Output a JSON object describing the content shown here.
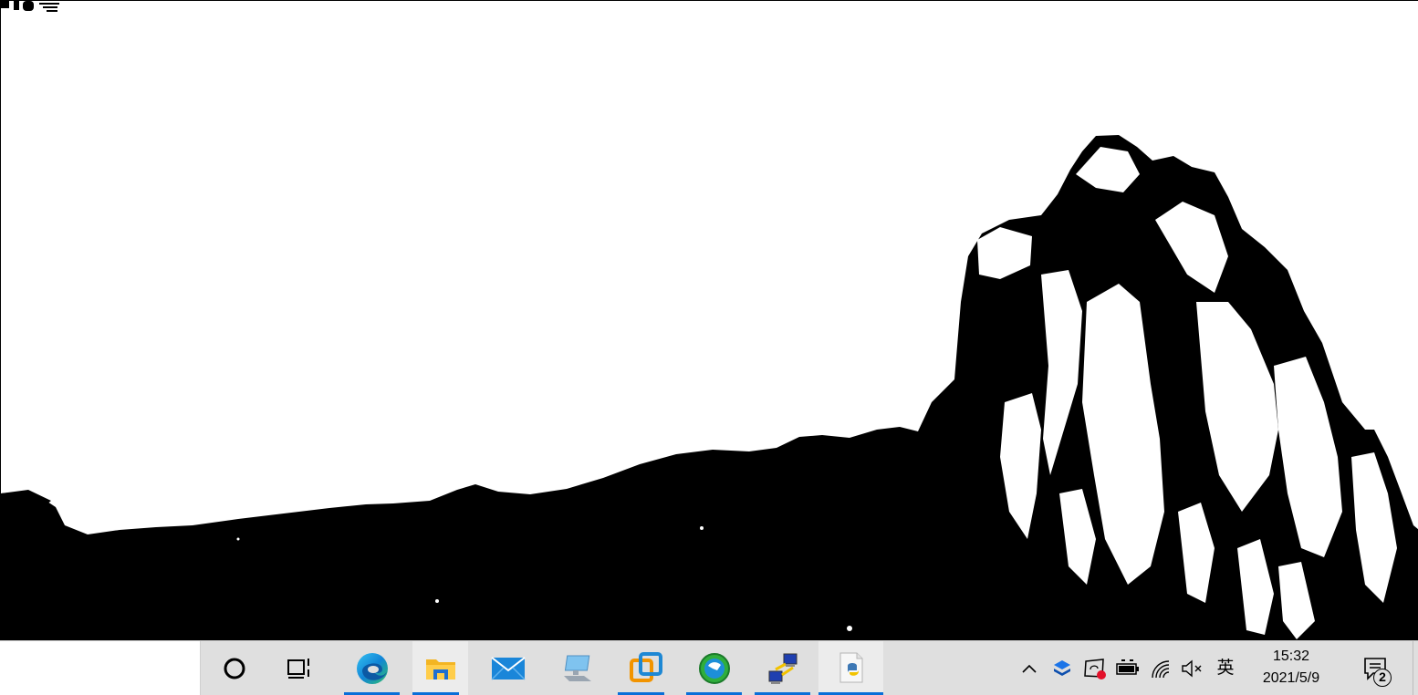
{
  "desktop": {
    "wallpaper": "black-and-white-mountain-wallpaper",
    "colors": {
      "foreground": "#000000",
      "background": "#ffffff"
    }
  },
  "taskbar": {
    "background": "#dfdfdf",
    "accent": "#0a6fd8",
    "search_box": {
      "placeholder": ""
    },
    "buttons": [
      {
        "name": "cortana-button",
        "icon": "cortana-circle-icon"
      },
      {
        "name": "task-view-button",
        "icon": "task-view-icon"
      },
      {
        "name": "edge-button",
        "icon": "edge-icon",
        "running": true
      },
      {
        "name": "file-explorer-button",
        "icon": "folder-icon",
        "running": true
      },
      {
        "name": "mail-button",
        "icon": "mail-icon"
      },
      {
        "name": "this-pc-button",
        "icon": "computer-icon"
      },
      {
        "name": "vmware-button",
        "icon": "vmware-icon",
        "running": true
      },
      {
        "name": "browser-app-button",
        "icon": "globe-icon",
        "running": true
      },
      {
        "name": "network-transfer-button",
        "icon": "network-icon",
        "running": true
      },
      {
        "name": "python-button",
        "icon": "python-file-icon",
        "running": true
      }
    ]
  },
  "tray": {
    "icons": [
      "chevron-up-icon",
      "dropbox-icon",
      "app-sync-icon",
      "battery-icon",
      "wifi-icon",
      "volume-muted-icon"
    ],
    "ime": "英",
    "clock": {
      "time": "15:32",
      "date": "2021/5/9"
    },
    "notifications": {
      "count": "2"
    }
  }
}
